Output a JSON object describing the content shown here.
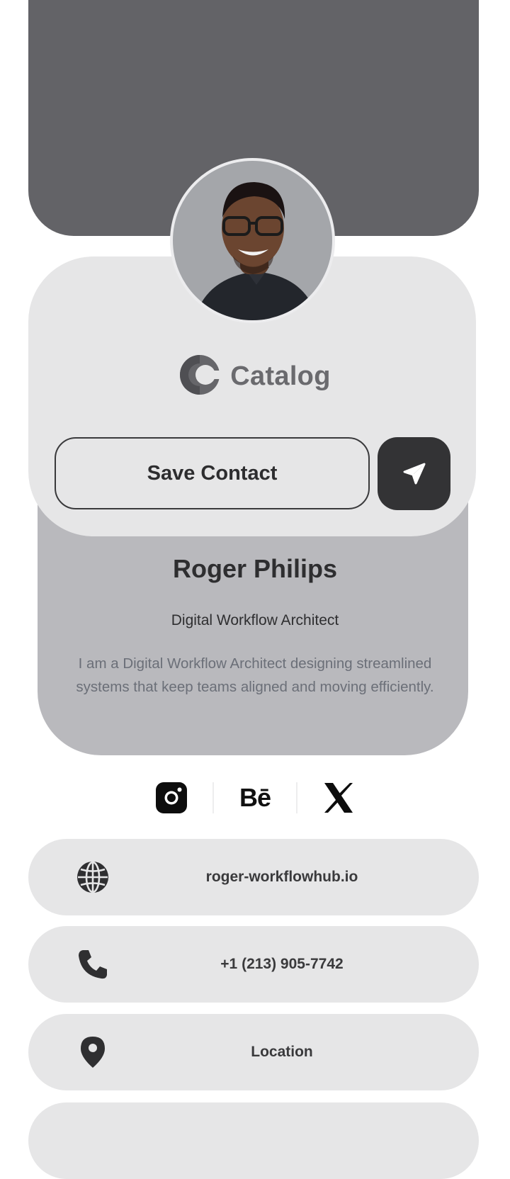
{
  "profile": {
    "company": "Catalog",
    "name": "Roger Philips",
    "title": "Digital Workflow Architect",
    "bio": "I am a Digital Workflow Architect designing streamlined systems that keep teams aligned and moving efficiently."
  },
  "actions": {
    "save_label": "Save Contact",
    "share_icon": "send-icon"
  },
  "social": [
    {
      "name": "instagram",
      "icon": "instagram-icon"
    },
    {
      "name": "behance",
      "icon": "behance-icon",
      "glyph": "Bē"
    },
    {
      "name": "x",
      "icon": "x-icon"
    }
  ],
  "contacts": [
    {
      "icon": "globe-icon",
      "label": "roger-workflowhub.io"
    },
    {
      "icon": "phone-icon",
      "label": "+1 (213) 905-7742"
    },
    {
      "icon": "location-pin-icon",
      "label": "Location"
    }
  ],
  "colors": {
    "hero": "#636367",
    "card": "#e6e6e7",
    "bio_card": "#b9b9bd",
    "accent_dark": "#333335"
  }
}
